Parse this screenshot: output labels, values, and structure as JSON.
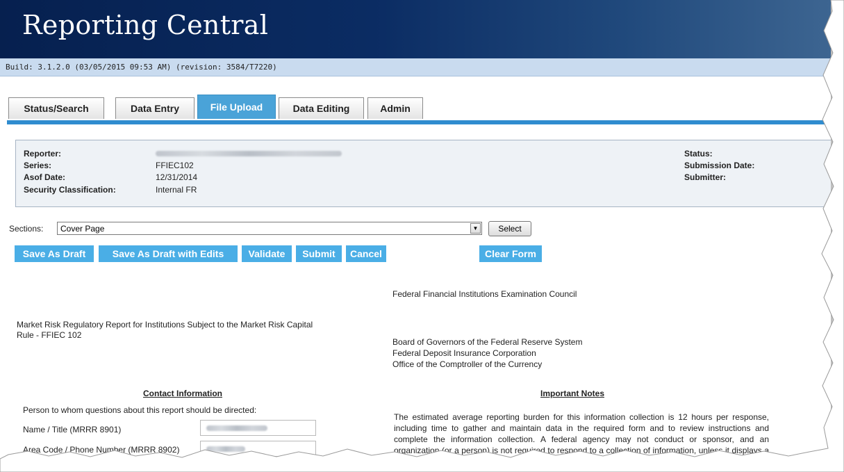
{
  "app": {
    "title": "Reporting Central",
    "build": "Build: 3.1.2.0 (03/05/2015 09:53 AM) (revision: 3584/T7220)"
  },
  "tabs": [
    {
      "label": "Status/Search",
      "active": false
    },
    {
      "label": "Data Entry",
      "active": false
    },
    {
      "label": "File Upload",
      "active": true
    },
    {
      "label": "Data Editing",
      "active": false
    },
    {
      "label": "Admin",
      "active": false
    }
  ],
  "info": {
    "reporter_label": "Reporter:",
    "series_label": "Series:",
    "series_value": "FFIEC102",
    "asof_label": "Asof Date:",
    "asof_value": "12/31/2014",
    "security_label": "Security Classification:",
    "security_value": "Internal FR",
    "status_label": "Status:",
    "submission_label": "Submission Date:",
    "submitter_label": "Submitter:"
  },
  "sections": {
    "label": "Sections:",
    "selected": "Cover Page",
    "select_button": "Select"
  },
  "actions": {
    "save_draft": "Save As Draft",
    "save_draft_edits": "Save As Draft with Edits",
    "validate": "Validate",
    "submit": "Submit",
    "cancel": "Cancel",
    "clear_form": "Clear Form"
  },
  "form": {
    "council": "Federal Financial Institutions Examination Council",
    "report_title_line1": "Market Risk Regulatory Report for Institutions Subject to the Market Risk Capital",
    "report_title_line2": "Rule - FFIEC 102",
    "agency1": "Board of Governors of the Federal Reserve System",
    "agency2": "Federal Deposit Insurance Corporation",
    "agency3": "Office of the Comptroller of the Currency",
    "contact_heading": "Contact Information",
    "notes_heading": "Important Notes",
    "contact_prompt": "Person to whom questions about this report should be directed:",
    "name_label": "Name / Title (MRRR 8901)",
    "phone_label": "Area Code / Phone Number (MRRR 8902)",
    "notes_text": "The estimated average reporting burden for this information collection is 12 hours per response, including time to gather and maintain data in the required form and to review instructions and complete the information collection. A federal agency may not conduct or sponsor, and an organization (or a person) is not required to respond to a collection of information, unless it displays a currently valid OMB control number."
  },
  "colors": {
    "banner": "#0b2c63",
    "accent": "#4aaee6",
    "tab_active": "#4aa3d8"
  }
}
